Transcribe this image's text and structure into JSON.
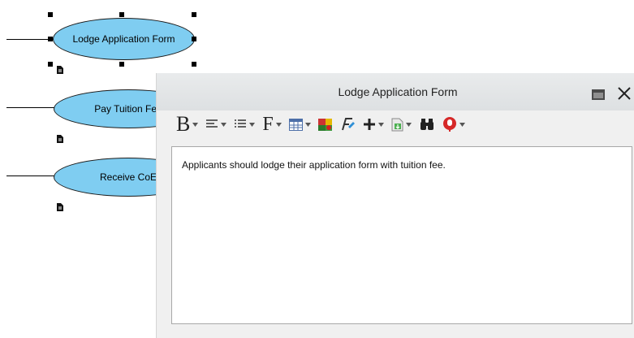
{
  "diagram": {
    "use_cases": [
      {
        "label": "Lodge Application Form"
      },
      {
        "label": "Pay Tuition Fee"
      },
      {
        "label": "Receive CoE"
      }
    ],
    "colors": {
      "use_case_fill": "#7fcdf1",
      "line": "#000000"
    }
  },
  "popup": {
    "title": "Lodge Application Form",
    "toolbar": {
      "bold_glyph": "B",
      "font_glyph": "F",
      "icons": [
        "bold-icon",
        "align-icon",
        "list-icon",
        "font-icon",
        "table-icon",
        "color-picker-icon",
        "clear-format-icon",
        "insert-icon",
        "attachment-icon",
        "find-icon",
        "spellcheck-icon"
      ]
    },
    "content": "Applicants should lodge their application form with tuition fee."
  }
}
